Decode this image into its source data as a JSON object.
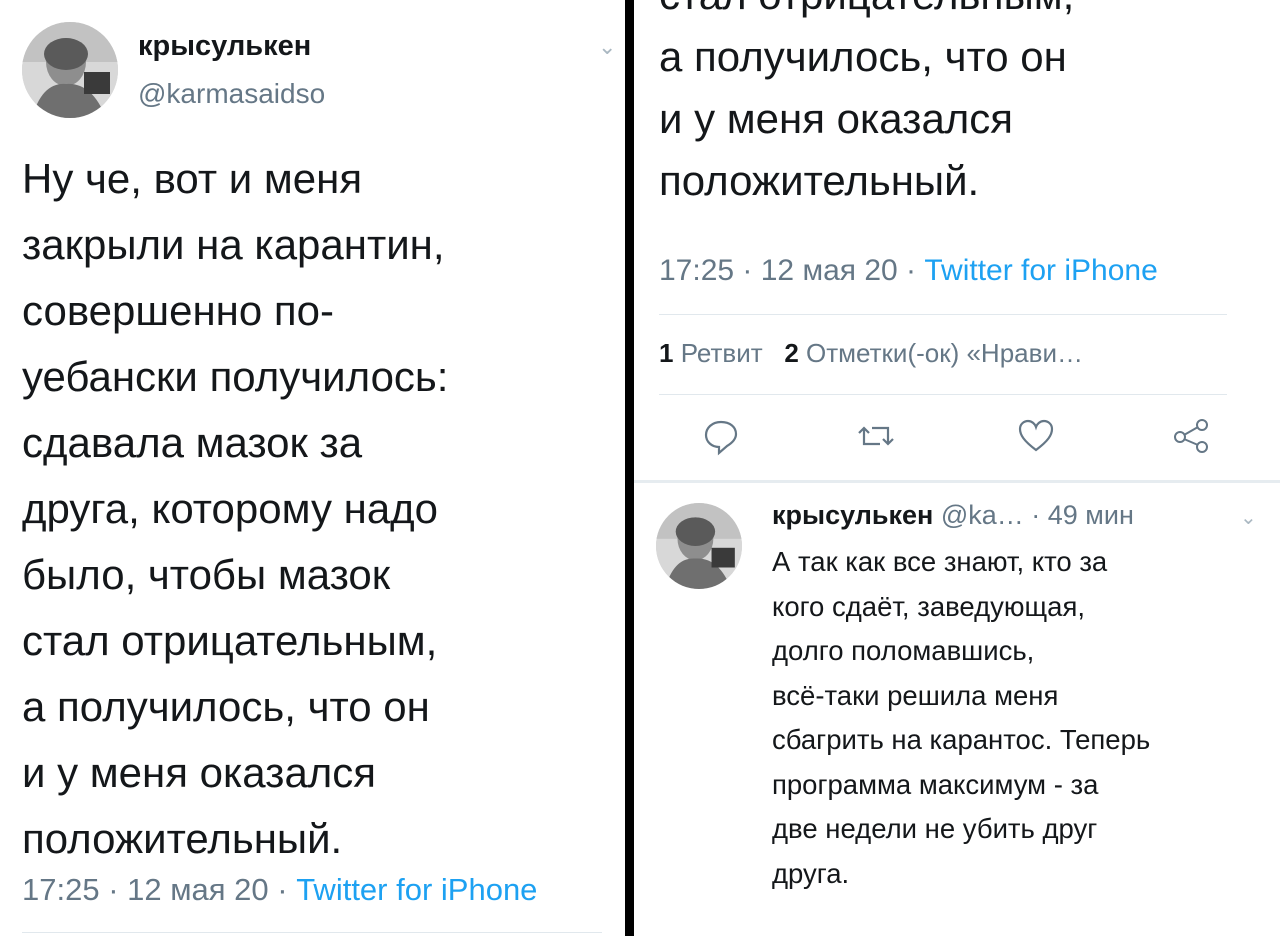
{
  "left_tweet": {
    "display_name": "крысулькен",
    "handle": "@karmasaidso",
    "body_lines": "Ну че, вот и меня\nзакрыли на карантин,\nсовершенно по-\nуебански получилось:\nсдавала мазок за\nдруга, которому надо\nбыло, чтобы мазок\nстал отрицательным,\nа получилось, что он\nи у меня оказался\nположительный.",
    "time": "17:25 · 12 мая 20 · ",
    "source": "Twitter for iPhone",
    "menu_icon": "chevron-down-icon"
  },
  "right_tweet": {
    "body_lines": "стал отрицательным,\nа получилось, что он\nи у меня оказался\nположительный.",
    "time": "17:25 · 12 мая 20 · ",
    "source": "Twitter for iPhone",
    "retweets_count": "1",
    "retweets_label": "Ретвит",
    "likes_count": "2",
    "likes_label": "Отметки(-ок) «Нрави…",
    "actions": [
      "reply-icon",
      "retweet-icon",
      "like-icon",
      "share-icon"
    ]
  },
  "reply": {
    "display_name": "крысулькен",
    "handle": "@ka…",
    "time": " · 49 мин",
    "body_lines": "А так как все знают, кто за\nкого сдаёт, заведующая,\nдолго поломавшись,\nвсё-таки решила меня\nсбагрить на карантос. Теперь\nпрограмма максимум - за\nдве недели не убить друг\nдруга.",
    "menu_icon": "chevron-down-icon"
  },
  "colors": {
    "text": "#14171a",
    "muted": "#657786",
    "link": "#1da1f2",
    "divider": "#000000"
  }
}
